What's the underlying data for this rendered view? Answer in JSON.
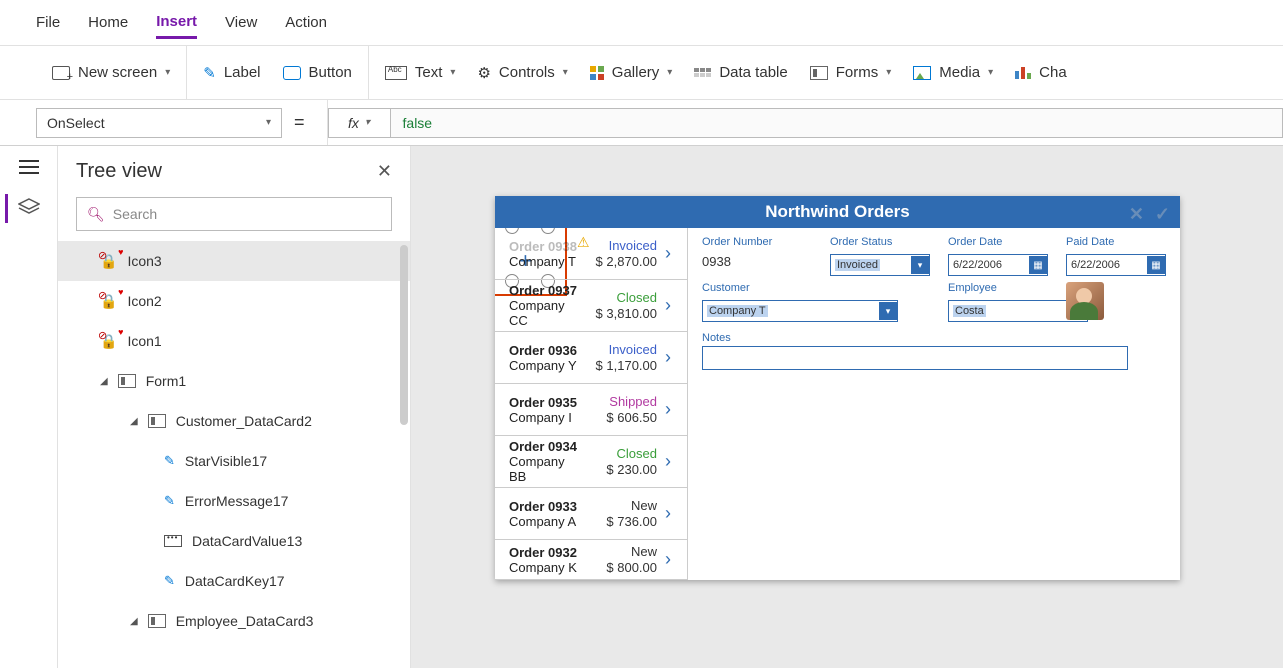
{
  "menu": {
    "file": "File",
    "home": "Home",
    "insert": "Insert",
    "view": "View",
    "action": "Action"
  },
  "ribbon": {
    "new_screen": "New screen",
    "label": "Label",
    "button": "Button",
    "text": "Text",
    "controls": "Controls",
    "gallery": "Gallery",
    "data_table": "Data table",
    "forms": "Forms",
    "media": "Media",
    "chart": "Cha"
  },
  "formula": {
    "property": "OnSelect",
    "fx": "fx",
    "expression": "false"
  },
  "tree": {
    "title": "Tree view",
    "search_ph": "Search",
    "nodes": [
      {
        "label": "Icon3",
        "kind": "icon"
      },
      {
        "label": "Icon2",
        "kind": "icon"
      },
      {
        "label": "Icon1",
        "kind": "icon"
      },
      {
        "label": "Form1",
        "kind": "form"
      },
      {
        "label": "Customer_DataCard2",
        "kind": "card"
      },
      {
        "label": "StarVisible17",
        "kind": "pen"
      },
      {
        "label": "ErrorMessage17",
        "kind": "pen"
      },
      {
        "label": "DataCardValue13",
        "kind": "box"
      },
      {
        "label": "DataCardKey17",
        "kind": "pen"
      },
      {
        "label": "Employee_DataCard3",
        "kind": "card"
      }
    ]
  },
  "app": {
    "title": "Northwind Orders",
    "orders": [
      {
        "order": "Order 0938",
        "company": "Company T",
        "status": "Invoiced",
        "status_cls": "s-inv",
        "amount": "$ 2,870.00",
        "warn": true
      },
      {
        "order": "Order 0937",
        "company": "Company CC",
        "status": "Closed",
        "status_cls": "s-closed",
        "amount": "$ 3,810.00"
      },
      {
        "order": "Order 0936",
        "company": "Company Y",
        "status": "Invoiced",
        "status_cls": "s-inv",
        "amount": "$ 1,170.00"
      },
      {
        "order": "Order 0935",
        "company": "Company I",
        "status": "Shipped",
        "status_cls": "s-ship",
        "amount": "$ 606.50"
      },
      {
        "order": "Order 0934",
        "company": "Company BB",
        "status": "Closed",
        "status_cls": "s-closed",
        "amount": "$ 230.00"
      },
      {
        "order": "Order 0933",
        "company": "Company A",
        "status": "New",
        "status_cls": "s-new",
        "amount": "$ 736.00"
      },
      {
        "order": "Order 0932",
        "company": "Company K",
        "status": "New",
        "status_cls": "s-new",
        "amount": "$ 800.00"
      }
    ],
    "form": {
      "order_number_lbl": "Order Number",
      "order_number": "0938",
      "order_status_lbl": "Order Status",
      "order_status": "Invoiced",
      "order_date_lbl": "Order Date",
      "order_date": "6/22/2006",
      "paid_date_lbl": "Paid Date",
      "paid_date": "6/22/2006",
      "customer_lbl": "Customer",
      "customer": "Company T",
      "employee_lbl": "Employee",
      "employee": "Costa",
      "notes_lbl": "Notes"
    }
  }
}
